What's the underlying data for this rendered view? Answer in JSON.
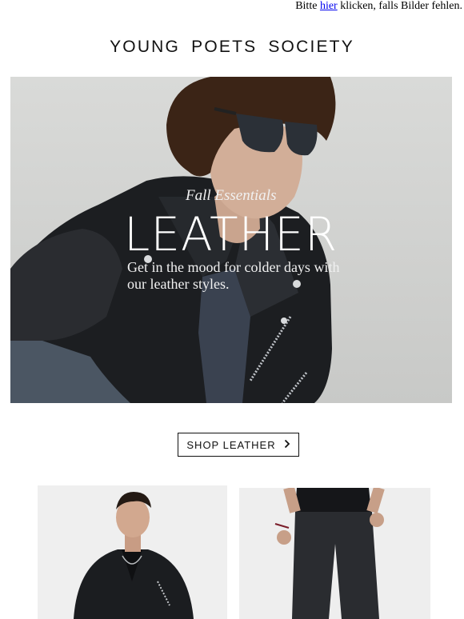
{
  "preheader": {
    "before": "Bitte ",
    "link": "hier",
    "after": " klicken, falls Bilder fehlen."
  },
  "brand": {
    "name": "YOUNG POETS SOCIETY"
  },
  "hero": {
    "kicker": "Fall Essentials",
    "headline": "LEATHER",
    "subline": "Get in the mood for colder days with our leather styles."
  },
  "cta": {
    "label": "SHOP LEATHER",
    "icon": "chevron-right-icon"
  },
  "products": [
    {
      "image": "leather-biker-jacket-photo"
    },
    {
      "image": "leather-trousers-photo"
    }
  ],
  "colors": {
    "text": "#111111",
    "link": "#0000ee",
    "hero_bg": "#d3d4d2",
    "leather": "#1b1d20"
  }
}
